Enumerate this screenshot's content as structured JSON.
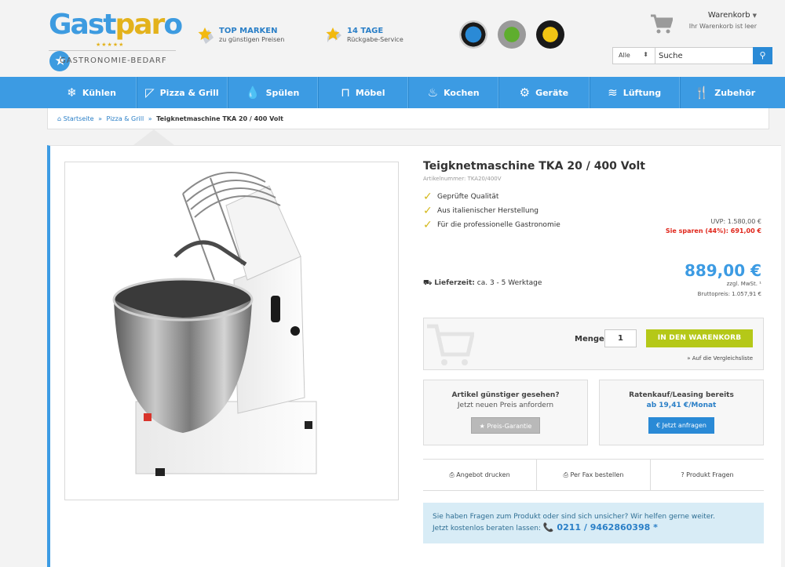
{
  "header": {
    "logo": {
      "word_1": "Gast",
      "word_2": "par",
      "word_3": "o",
      "stars": "★★★★★",
      "subtitle": "GASTRONOMIE-BEDARF"
    },
    "usps": [
      {
        "title": "TOP MARKEN",
        "subtitle": "zu günstigen Preisen"
      },
      {
        "title": "14 TAGE",
        "subtitle": "Rückgabe-Service"
      }
    ],
    "cart": {
      "title": "Warenkorb",
      "subtitle": "Ihr Warenkorb ist leer"
    },
    "search": {
      "category": "Alle",
      "placeholder": "Suche"
    }
  },
  "nav": {
    "items": [
      {
        "label": "Kühlen",
        "icon": "❄"
      },
      {
        "label": "Pizza & Grill",
        "icon": "◸"
      },
      {
        "label": "Spülen",
        "icon": "💧"
      },
      {
        "label": "Möbel",
        "icon": "⊓"
      },
      {
        "label": "Kochen",
        "icon": "♨"
      },
      {
        "label": "Geräte",
        "icon": "⚙"
      },
      {
        "label": "Lüftung",
        "icon": "≋"
      },
      {
        "label": "Zubehör",
        "icon": "🍴"
      }
    ]
  },
  "breadcrumb": {
    "home": "Startseite",
    "category": "Pizza & Grill",
    "current": "Teigknetmaschine TKA 20 / 400 Volt",
    "separator": "»"
  },
  "product": {
    "title": "Teigknetmaschine TKA 20 / 400 Volt",
    "sku": "Artikelnummer: TKA20/400V",
    "features": [
      "Geprüfte Qualität",
      "Aus italienischer Herstellung",
      "Für die professionelle Gastronomie"
    ],
    "uvp": "UVP: 1.580,00 €",
    "savings": "Sie sparen (44%): 691,00 €",
    "price": "889,00 €",
    "vat": "zzgl. MwSt. ¹",
    "gross": "Bruttopreis: 1.057,91 €",
    "delivery_label": "Lieferzeit:",
    "delivery_value": "ca. 3 - 5 Werktage"
  },
  "buy": {
    "qty_label": "Menge",
    "qty_value": "1",
    "add_to_cart": "IN DEN WARENKORB",
    "compare": "» Auf die Vergleichsliste"
  },
  "price_guarantee": {
    "title": "Artikel günstiger gesehen?",
    "subtitle": "Jetzt neuen Preis anfordern",
    "button": "★ Preis-Garantie"
  },
  "leasing": {
    "title": "Ratenkauf/Leasing bereits",
    "subtitle": "ab 19,41 €/Monat",
    "button": "€ Jetzt anfragen"
  },
  "actions": [
    "⎙ Angebot drucken",
    "⎙ Per Fax bestellen",
    "? Produkt Fragen"
  ],
  "help": {
    "line1": "Sie haben Fragen zum Produkt oder sind sich unsicher? Wir helfen gerne weiter.",
    "line2": "Jetzt kostenlos beraten lassen:",
    "phone": "📞 0211 / 9462860398 *"
  },
  "colors": {
    "brand_blue": "#3c9be3",
    "accent_yellow": "#e3b21c",
    "cart_green": "#b5c818",
    "sale_red": "#e0261b"
  }
}
